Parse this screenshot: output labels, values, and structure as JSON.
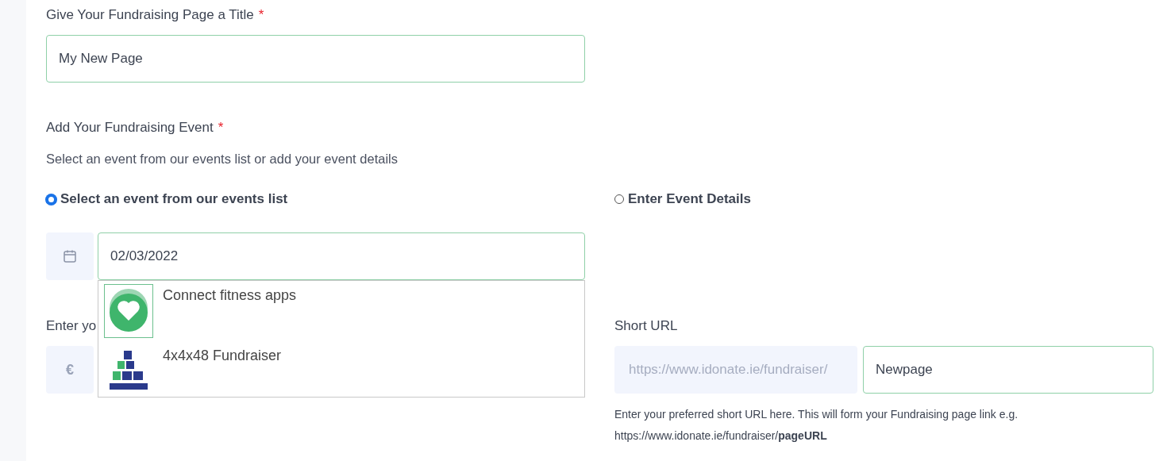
{
  "title_field": {
    "label": "Give Your Fundraising Page a Title",
    "required_mark": "*",
    "value": "My New Page"
  },
  "event_section": {
    "label": "Add Your Fundraising Event",
    "required_mark": "*",
    "description": "Select an event from our events list or add your event details",
    "options": [
      {
        "label": "Select an event from our events list",
        "selected": true
      },
      {
        "label": "Enter Event Details",
        "selected": false
      }
    ],
    "date_field": {
      "value": "02/03/2022"
    },
    "suggestions": [
      {
        "kind": "app-logo",
        "label": "Connect fitness apps",
        "selected": true
      },
      {
        "kind": "picture",
        "label": "4x4x48 Fundraiser",
        "selected": false
      }
    ]
  },
  "amount_field": {
    "label": "Enter yo",
    "currency": "€"
  },
  "short_url": {
    "label": "Short URL",
    "prefix": "https://www.idonate.ie/fundraiser/",
    "value": "Newpage",
    "help": "Enter your preferred short URL here. This will form your Fundraising page link e.g. https://www.idonate.ie/fundraiser/**pageURL**"
  }
}
